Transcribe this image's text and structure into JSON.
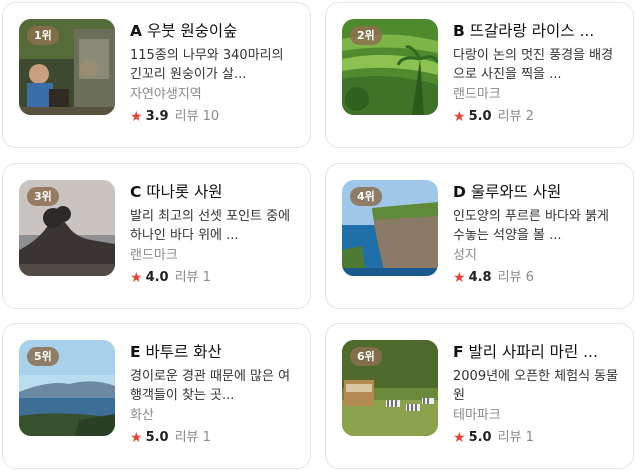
{
  "items": [
    {
      "rank": "1위",
      "letter": "A",
      "name": "우붓 원숭이숲",
      "desc": "115종의 나무와 340마리의 긴꼬리 원숭이가 살...",
      "category": "자연야생지역",
      "score": "3.9",
      "review_label": "리뷰",
      "review_count": "10",
      "image_icon": "monkey-forest-photo"
    },
    {
      "rank": "2위",
      "letter": "B",
      "name": "뜨갈라랑 라이스 ...",
      "desc": "다랑이 논의 멋진 풍경을 배경으로 사진을 찍을 ...",
      "category": "랜드마크",
      "score": "5.0",
      "review_label": "리뷰",
      "review_count": "2",
      "image_icon": "rice-terrace-photo"
    },
    {
      "rank": "3위",
      "letter": "C",
      "name": "따나롯 사원",
      "desc": "발리 최고의 선셋 포인트 중에 하나인 바다 위에 ...",
      "category": "랜드마크",
      "score": "4.0",
      "review_label": "리뷰",
      "review_count": "1",
      "image_icon": "sea-temple-photo"
    },
    {
      "rank": "4위",
      "letter": "D",
      "name": "울루와뜨 사원",
      "desc": "인도양의 푸르른 바다와 붉게 수놓는 석양을 볼 ...",
      "category": "성지",
      "score": "4.8",
      "review_label": "리뷰",
      "review_count": "6",
      "image_icon": "cliff-temple-photo"
    },
    {
      "rank": "5위",
      "letter": "E",
      "name": "바투르 화산",
      "desc": "경이로운 경관 때문에 많은 여행객들이 찾는 곳...",
      "category": "화산",
      "score": "5.0",
      "review_label": "리뷰",
      "review_count": "1",
      "image_icon": "volcano-lake-photo"
    },
    {
      "rank": "6위",
      "letter": "F",
      "name": "발리 사파리 마린 ...",
      "desc": "2009년에 오픈한 체험식 동물원",
      "category": "테마파크",
      "score": "5.0",
      "review_label": "리뷰",
      "review_count": "1",
      "image_icon": "safari-zebra-photo"
    }
  ],
  "colors": {
    "star": "#e8443a",
    "rank_badge": "#8c6e50",
    "muted": "#8a8a8a"
  }
}
